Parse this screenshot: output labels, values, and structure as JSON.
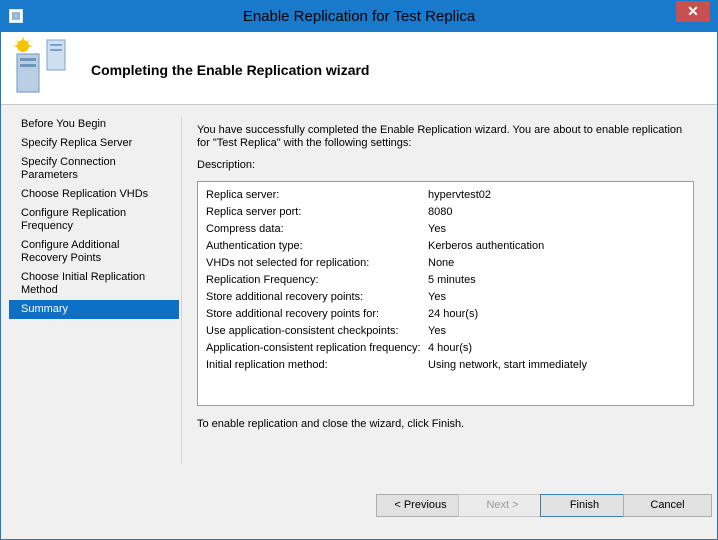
{
  "window": {
    "title": "Enable Replication for Test Replica",
    "close_label": "✕"
  },
  "header": {
    "title": "Completing the Enable Replication wizard"
  },
  "nav": {
    "items": [
      {
        "id": "before-you-begin",
        "lines": [
          "Before You Begin"
        ]
      },
      {
        "id": "specify-replica-server",
        "lines": [
          "Specify Replica Server"
        ]
      },
      {
        "id": "specify-connection-parameters",
        "lines": [
          "Specify Connection",
          "Parameters"
        ]
      },
      {
        "id": "choose-replication-vhds",
        "lines": [
          "Choose Replication VHDs"
        ]
      },
      {
        "id": "configure-replication-frequency",
        "lines": [
          "Configure Replication",
          "Frequency"
        ]
      },
      {
        "id": "configure-additional-recovery-points",
        "lines": [
          "Configure Additional",
          "Recovery Points"
        ]
      },
      {
        "id": "choose-initial-replication-method",
        "lines": [
          "Choose Initial Replication",
          "Method"
        ]
      },
      {
        "id": "summary",
        "lines": [
          "Summary"
        ],
        "selected": true
      }
    ]
  },
  "content": {
    "intro": "You have successfully completed the Enable Replication wizard. You are about to enable replication for \"Test Replica\" with the following settings:",
    "description_label": "Description:",
    "settings": [
      {
        "key": "Replica server:",
        "value": "hypervtest02"
      },
      {
        "key": "Replica server port:",
        "value": "8080"
      },
      {
        "key": "Compress data:",
        "value": "Yes"
      },
      {
        "key": "Authentication type:",
        "value": "Kerberos authentication"
      },
      {
        "key": "VHDs not selected for replication:",
        "value": "None"
      },
      {
        "key": "Replication Frequency:",
        "value": "5 minutes"
      },
      {
        "key": "Store additional recovery points:",
        "value": "Yes"
      },
      {
        "key": "Store additional recovery points for:",
        "value": "24 hour(s)"
      },
      {
        "key": "Use application-consistent checkpoints:",
        "value": "Yes"
      },
      {
        "key": "Application-consistent replication frequency:",
        "value": "4 hour(s)"
      },
      {
        "key": "Initial replication method:",
        "value": "Using network, start immediately"
      }
    ],
    "finish_note": "To enable replication and close the wizard, click Finish."
  },
  "buttons": {
    "previous": "< Previous",
    "next": "Next >",
    "finish": "Finish",
    "cancel": "Cancel"
  },
  "colors": {
    "titlebar": "#1979ca",
    "selected_nav": "#0e6fc6",
    "close_button": "#c75050"
  },
  "icons": {
    "system_menu": "server-icon",
    "header": "replication-server-icon"
  }
}
